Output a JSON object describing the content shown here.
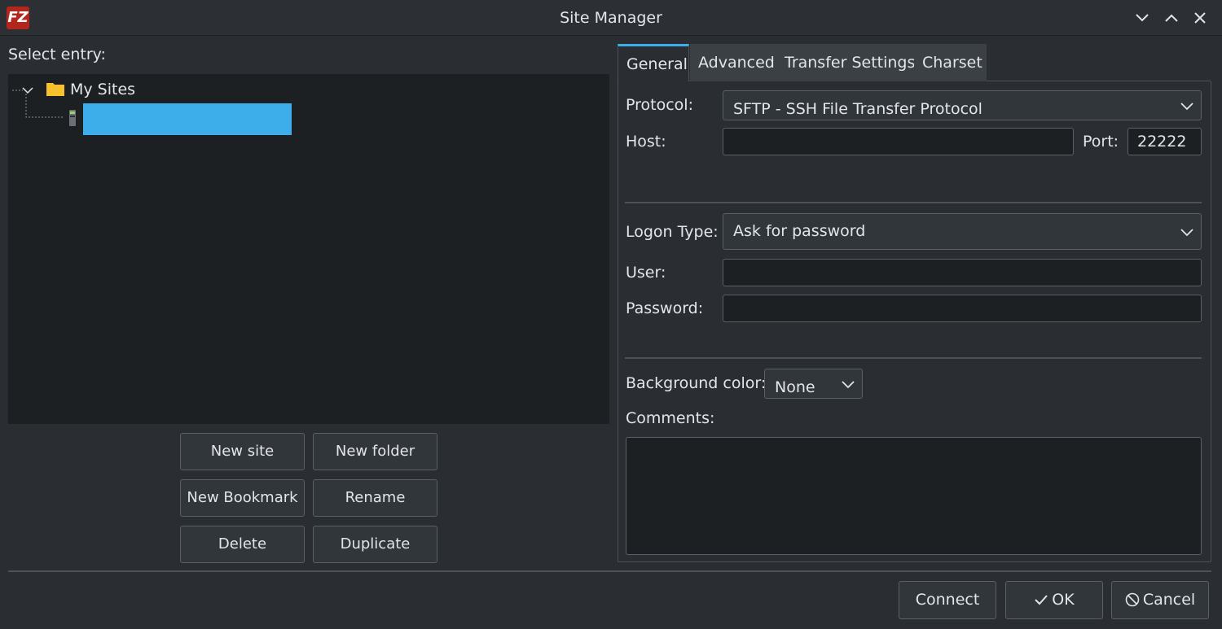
{
  "window": {
    "title": "Site Manager",
    "app_logo": "FZ",
    "controls": [
      "minimize-icon",
      "maximize-icon",
      "close-icon"
    ]
  },
  "left": {
    "select_label": "Select entry:",
    "tree": {
      "root_label": "My Sites",
      "root_icon": "folder-icon",
      "child_icon": "server-icon",
      "child_label": "",
      "selection_color": "#3daee9"
    },
    "buttons": {
      "new_site": "New site",
      "new_folder": "New folder",
      "new_bookmark": "New Bookmark",
      "rename": "Rename",
      "delete": "Delete",
      "duplicate": "Duplicate"
    }
  },
  "tabs": [
    {
      "label": "General",
      "active": true
    },
    {
      "label": "Advanced",
      "active": false
    },
    {
      "label": "Transfer Settings",
      "active": false
    },
    {
      "label": "Charset",
      "active": false
    }
  ],
  "general": {
    "protocol_label": "Protocol:",
    "protocol_value": "SFTP - SSH File Transfer Protocol",
    "host_label": "Host:",
    "host_value": "",
    "port_label": "Port:",
    "port_value": "22222",
    "logon_type_label": "Logon Type:",
    "logon_type_value": "Ask for password",
    "user_label": "User:",
    "user_value": "",
    "password_label": "Password:",
    "password_value": "",
    "bg_color_label": "Background color:",
    "bg_color_value": "None",
    "comments_label": "Comments:",
    "comments_value": ""
  },
  "footer": {
    "connect": "Connect",
    "ok": "OK",
    "cancel": "Cancel"
  },
  "colors": {
    "accent": "#3daee9",
    "background": "#2a2e32",
    "field": "#1d2023"
  }
}
